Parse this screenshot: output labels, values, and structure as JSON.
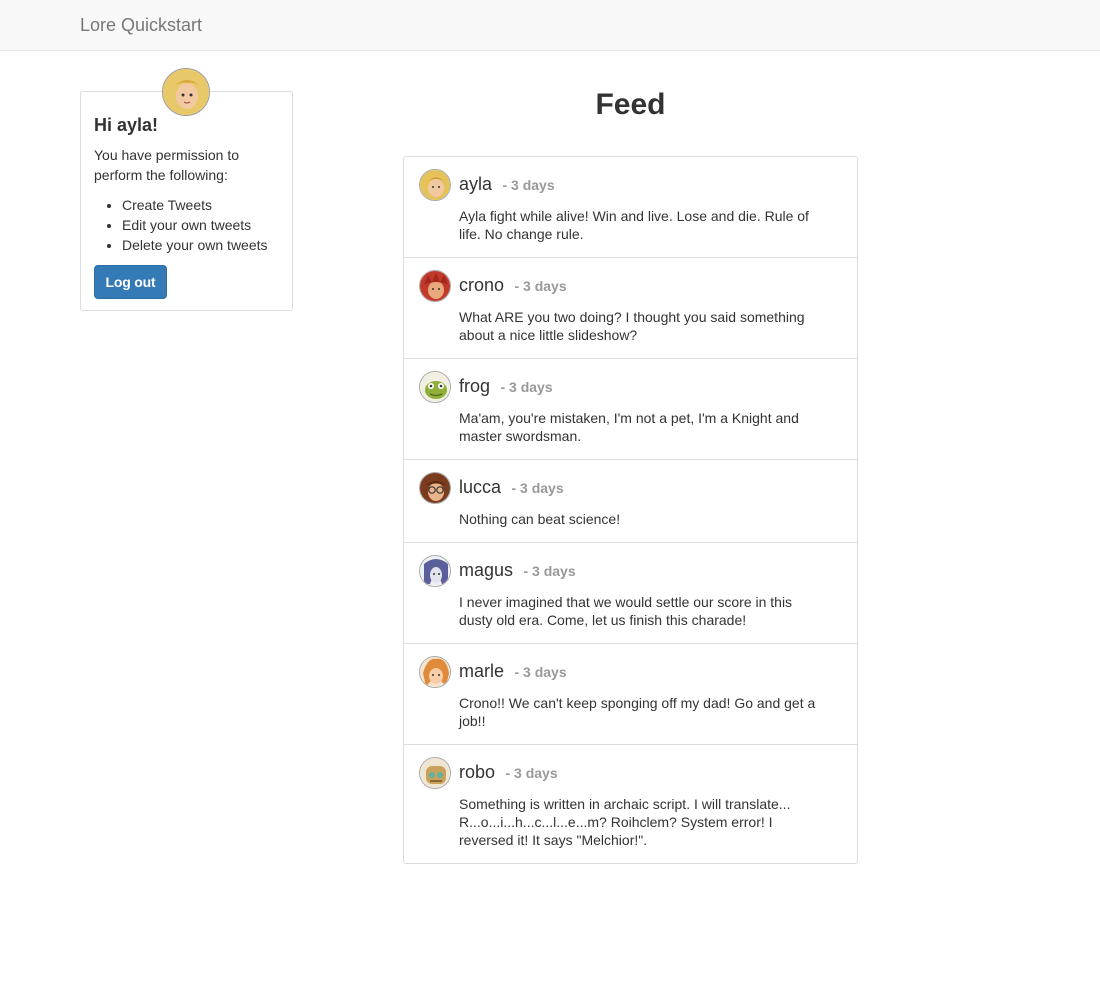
{
  "navbar": {
    "brand": "Lore Quickstart"
  },
  "profile": {
    "greeting": "Hi ayla!",
    "permission_text": "You have permission to perform the following:",
    "permissions": [
      "Create Tweets",
      "Edit your own tweets",
      "Delete your own tweets"
    ],
    "logout_label": "Log out",
    "avatar_colors": {
      "hair": "#e8c868",
      "skin": "#f2c9a0"
    }
  },
  "feed": {
    "title": "Feed",
    "tweets": [
      {
        "user": "ayla",
        "time": "- 3 days",
        "text": "Ayla fight while alive! Win and live. Lose and die. Rule of life. No change rule.",
        "hair": "#e5c25a",
        "skin": "#f1c9a1"
      },
      {
        "user": "crono",
        "time": "- 3 days",
        "text": "What ARE you two doing? I thought you said something about a nice little slideshow?",
        "hair": "#c0392b",
        "skin": "#e8a87c"
      },
      {
        "user": "frog",
        "time": "- 3 days",
        "text": "Ma'am, you're mistaken, I'm not a pet, I'm a Knight and master swordsman.",
        "hair": "#8fae3a",
        "skin": "#c9d98a"
      },
      {
        "user": "lucca",
        "time": "- 3 days",
        "text": "Nothing can beat science!",
        "hair": "#7a3b1e",
        "skin": "#e9b489"
      },
      {
        "user": "magus",
        "time": "- 3 days",
        "text": "I never imagined that we would settle our score in this dusty old era. Come, let us finish this charade!",
        "hair": "#5a5e9a",
        "skin": "#e2e2ec"
      },
      {
        "user": "marle",
        "time": "- 3 days",
        "text": "Crono!! We can't keep sponging off my dad! Go and get a job!!",
        "hair": "#e08a3c",
        "skin": "#f6cda8"
      },
      {
        "user": "robo",
        "time": "- 3 days",
        "text": "Something is written in archaic script. I will translate... R...o...i...h...c...l...e...m? Roihclem? System error! I reversed it! It says \"Melchior!\".",
        "hair": "#c9a15c",
        "skin": "#d7c9a6"
      }
    ]
  }
}
